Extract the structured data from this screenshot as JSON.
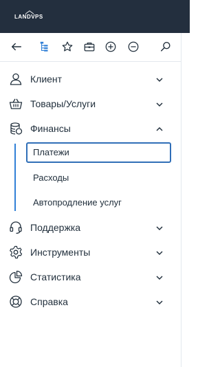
{
  "header": {
    "logo_text": "LANDVPS"
  },
  "toolbar": {
    "icons": [
      "back-icon",
      "tree-icon",
      "star-icon",
      "briefcase-icon",
      "plus-circle-icon",
      "minus-circle-icon",
      "search-icon"
    ]
  },
  "nav": {
    "items": [
      {
        "label": "Клиент",
        "icon": "user-icon",
        "expanded": false
      },
      {
        "label": "Товары/Услуги",
        "icon": "basket-icon",
        "expanded": false
      },
      {
        "label": "Финансы",
        "icon": "coins-icon",
        "expanded": true
      },
      {
        "label": "Поддержка",
        "icon": "headset-icon",
        "expanded": false
      },
      {
        "label": "Инструменты",
        "icon": "gear-icon",
        "expanded": false
      },
      {
        "label": "Статистика",
        "icon": "pie-chart-icon",
        "expanded": false
      },
      {
        "label": "Справка",
        "icon": "lifebuoy-icon",
        "expanded": false
      }
    ],
    "finance_sub": [
      {
        "label": "Платежи",
        "active": true
      },
      {
        "label": "Расходы",
        "active": false
      },
      {
        "label": "Автопродление услуг",
        "active": false
      }
    ]
  },
  "colors": {
    "topbar": "#232f3e",
    "accent": "#2f7fd6",
    "text": "#22303d"
  }
}
